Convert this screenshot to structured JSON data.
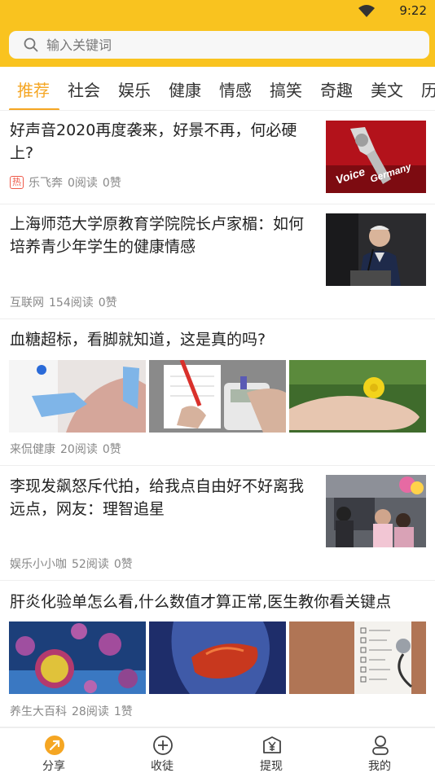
{
  "status_bar": {
    "time": "9:22",
    "wifi_icon": "wifi-icon"
  },
  "search": {
    "placeholder": "输入关键词",
    "icon": "search-icon"
  },
  "tabs": [
    {
      "label": "推荐",
      "active": true
    },
    {
      "label": "社会"
    },
    {
      "label": "娱乐"
    },
    {
      "label": "健康"
    },
    {
      "label": "情感"
    },
    {
      "label": "搞笑"
    },
    {
      "label": "奇趣"
    },
    {
      "label": "美文"
    },
    {
      "label": "历"
    }
  ],
  "articles": [
    {
      "title": "好声音2020再度袭来，好景不再，何必硬上?",
      "hot_badge": "热",
      "source": "乐飞奔",
      "reads": "0阅读",
      "likes": "0赞",
      "image": "voice-of-germany-thumbnail"
    },
    {
      "title": "上海师范大学原教育学院院长卢家楣：如何培养青少年学生的健康情感",
      "source": "互联网",
      "reads": "154阅读",
      "likes": "0赞",
      "image": "speaker-at-podium-thumbnail"
    },
    {
      "title": "血糖超标，看脚就知道，这是真的吗?",
      "source": "来侃健康",
      "reads": "20阅读",
      "likes": "0赞",
      "images": [
        "doctor-examining-leg",
        "blood-glucose-meter",
        "foot-with-dandelion"
      ]
    },
    {
      "title": "李现发飙怒斥代拍，给我点自由好不好离我远点，网友：理智追星",
      "source": "娱乐小小咖",
      "reads": "52阅读",
      "likes": "0赞",
      "image": "celebrity-crowd-thumbnail"
    },
    {
      "title": "肝炎化验单怎么看,什么数值才算正常,医生教你看关键点",
      "source": "养生大百科",
      "reads": "28阅读",
      "likes": "1赞",
      "images": [
        "virus-particles",
        "liver-illustration",
        "medical-checklist-stethoscope"
      ]
    }
  ],
  "bottom_nav": [
    {
      "label": "分享",
      "icon": "share-icon",
      "active": true
    },
    {
      "label": "收徒",
      "icon": "plus-circle-icon"
    },
    {
      "label": "提现",
      "icon": "wallet-yen-icon"
    },
    {
      "label": "我的",
      "icon": "profile-icon"
    }
  ],
  "colors": {
    "brand": "#f9c31f",
    "accent": "#f5a623",
    "hot": "#ee5a4a"
  }
}
